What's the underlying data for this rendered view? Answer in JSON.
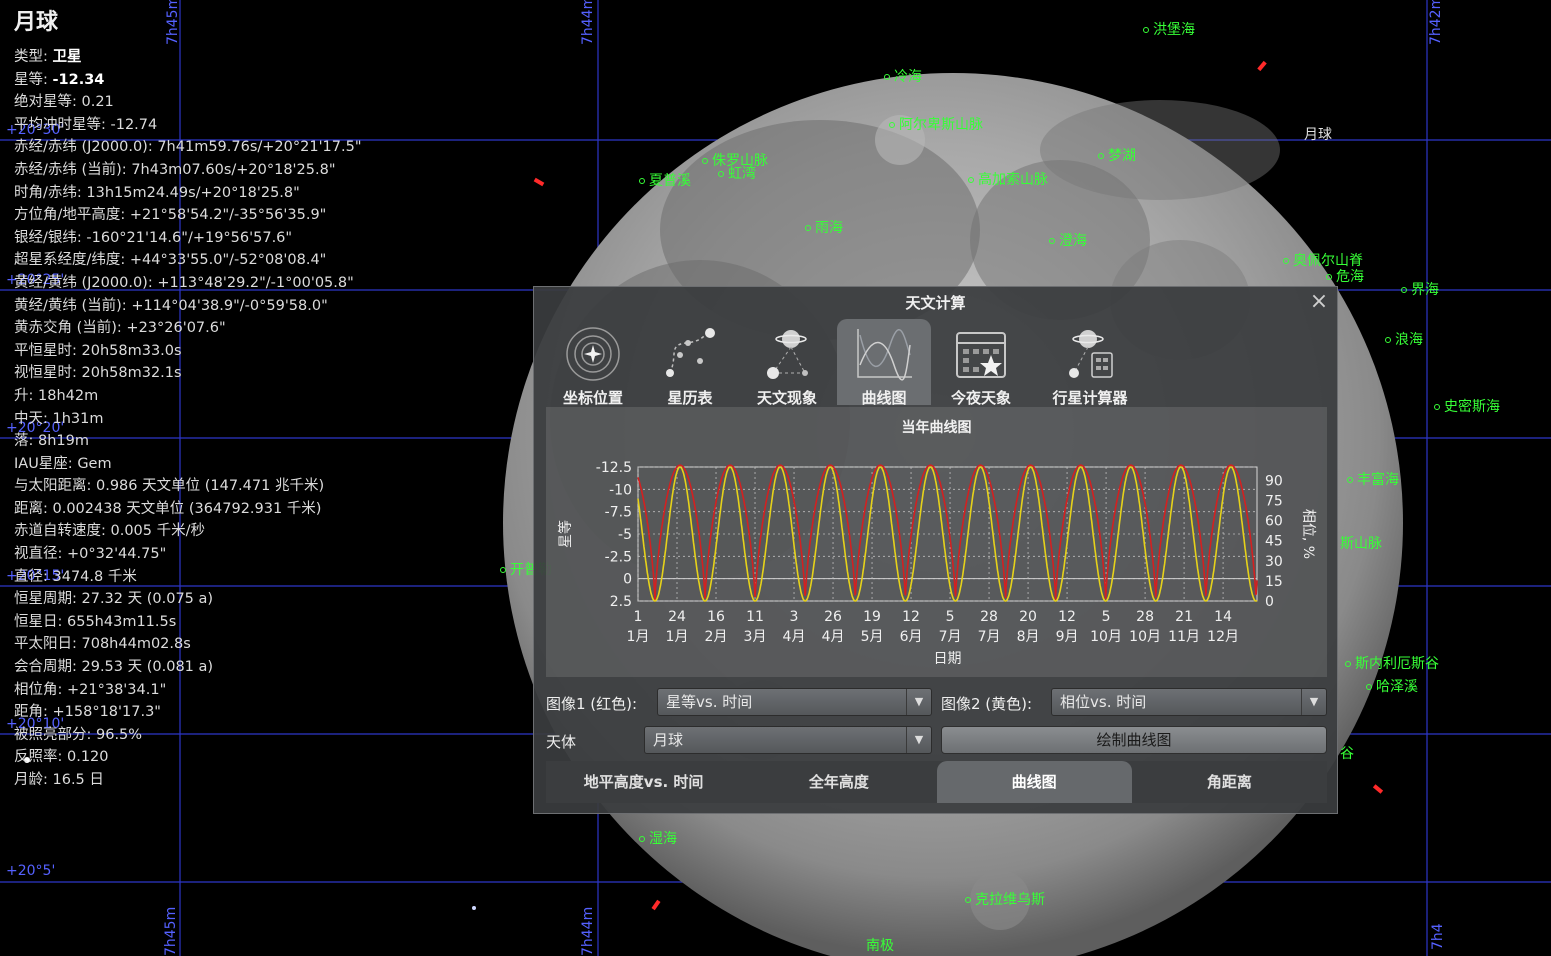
{
  "sky": {
    "grid_labels_h": [
      "7h45m",
      "7h44m",
      "7h42m",
      "7h45m",
      "7h44m",
      "7h4"
    ],
    "grid_labels_dec": [
      "+20°30'",
      "+20°25'",
      "+20°20'",
      "+20°15'",
      "+20°10'",
      "+20°5'"
    ],
    "moon_features": [
      {
        "name": "洪堡海"
      },
      {
        "name": "冷海"
      },
      {
        "name": "阿尔卑斯山脉"
      },
      {
        "name": "侏罗山脉"
      },
      {
        "name": "虹湾"
      },
      {
        "name": "夏普溪"
      },
      {
        "name": "梦湖"
      },
      {
        "name": "高加索山脉"
      },
      {
        "name": "雨海"
      },
      {
        "name": "澄海"
      },
      {
        "name": "奥佩尔山脊"
      },
      {
        "name": "危海"
      },
      {
        "name": "界海"
      },
      {
        "name": "浪海"
      },
      {
        "name": "史密斯海"
      },
      {
        "name": "丰富海"
      },
      {
        "name": "斯山脉"
      },
      {
        "name": "斯内利厄斯谷"
      },
      {
        "name": "哈泽溪"
      },
      {
        "name": "谷"
      },
      {
        "name": "克拉维乌斯"
      },
      {
        "name": "南极"
      },
      {
        "name": "湿海"
      },
      {
        "name": "开普勒"
      }
    ],
    "moon_name_label": "月球"
  },
  "info": {
    "title": "月球",
    "rows": [
      {
        "label": "类型: ",
        "value": "卫星",
        "bold": true
      },
      {
        "label": "星等: ",
        "value": "-12.34",
        "bold": true
      },
      {
        "label": "绝对星等: ",
        "value": "0.21"
      },
      {
        "label": "平均冲时星等: ",
        "value": "-12.74"
      },
      {
        "label": "赤经/赤纬 (J2000.0): ",
        "value": "7h41m59.76s/+20°21'17.5\""
      },
      {
        "label": "赤经/赤纬 (当前): ",
        "value": "7h43m07.60s/+20°18'25.8\""
      },
      {
        "label": "时角/赤纬: ",
        "value": "13h15m24.49s/+20°18'25.8\""
      },
      {
        "label": "方位角/地平高度: ",
        "value": "+21°58'54.2\"/-35°56'35.9\""
      },
      {
        "label": "银经/银纬: ",
        "value": "-160°21'14.6\"/+19°56'57.6\""
      },
      {
        "label": "超星系经度/纬度: ",
        "value": "+44°33'55.0\"/-52°08'08.4\""
      },
      {
        "label": "黄经/黄纬 (J2000.0): ",
        "value": "+113°48'29.2\"/-1°00'05.8\""
      },
      {
        "label": "黄经/黄纬 (当前): ",
        "value": "+114°04'38.9\"/-0°59'58.0\""
      },
      {
        "label": "黄赤交角 (当前): ",
        "value": "+23°26'07.6\""
      },
      {
        "label": "平恒星时: ",
        "value": "20h58m33.0s"
      },
      {
        "label": "视恒星时: ",
        "value": "20h58m32.1s"
      },
      {
        "label": "升: ",
        "value": "18h42m"
      },
      {
        "label": "中天: ",
        "value": "1h31m"
      },
      {
        "label": "落: ",
        "value": "8h19m"
      },
      {
        "label": "IAU星座: ",
        "value": "Gem"
      },
      {
        "label": "与太阳距离: ",
        "value": "0.986 天文单位 (147.471 兆千米)"
      },
      {
        "label": "距离: ",
        "value": "0.002438 天文单位 (364792.931 千米)"
      },
      {
        "label": "赤道自转速度: ",
        "value": "0.005 千米/秒"
      },
      {
        "label": "视直径: ",
        "value": "+0°32'44.75\""
      },
      {
        "label": "直径: ",
        "value": "3474.8 千米"
      },
      {
        "label": "恒星周期: ",
        "value": "27.32 天 (0.075 a)"
      },
      {
        "label": "恒星日: ",
        "value": "655h43m11.5s"
      },
      {
        "label": "平太阳日: ",
        "value": "708h44m02.8s"
      },
      {
        "label": "会合周期: ",
        "value": "29.53 天 (0.081 a)"
      },
      {
        "label": "相位角: ",
        "value": "+21°38'34.1\""
      },
      {
        "label": "距角: ",
        "value": "+158°18'17.3\""
      },
      {
        "label": "被照亮部分: ",
        "value": "96.5%"
      },
      {
        "label": "反照率: ",
        "value": "0.120"
      },
      {
        "label": "月龄: ",
        "value": "16.5 日"
      }
    ]
  },
  "dialog": {
    "title": "天文计算",
    "close_icon": "×",
    "tabs": [
      {
        "label": "坐标位置",
        "icon": "solar-system-icon"
      },
      {
        "label": "星历表",
        "icon": "ephemeris-icon"
      },
      {
        "label": "天文现象",
        "icon": "phenomena-icon"
      },
      {
        "label": "曲线图",
        "icon": "graph-icon",
        "active": true
      },
      {
        "label": "今夜天象",
        "icon": "calendar-star-icon"
      },
      {
        "label": "行星计算器",
        "icon": "planet-calculator-icon"
      }
    ],
    "chart_title": "当年曲线图",
    "graph1_label": "图像1 (红色):",
    "graph1_value": "星等vs. 时间",
    "graph2_label": "图像2 (黄色):",
    "graph2_value": "相位vs. 时间",
    "body_label": "天体",
    "body_value": "月球",
    "draw_button": "绘制曲线图",
    "subtabs": [
      {
        "label": "地平高度vs. 时间"
      },
      {
        "label": "全年高度"
      },
      {
        "label": "曲线图",
        "active": true
      },
      {
        "label": "角距离"
      }
    ]
  },
  "chart_data": {
    "type": "line",
    "title": "当年曲线图",
    "xlabel": "日期",
    "ylabel": "星等",
    "y2label": "相位, %",
    "x_ticks": [
      {
        "day": "1",
        "month": "1月"
      },
      {
        "day": "24",
        "month": "1月"
      },
      {
        "day": "16",
        "month": "2月"
      },
      {
        "day": "11",
        "month": "3月"
      },
      {
        "day": "3",
        "month": "4月"
      },
      {
        "day": "26",
        "month": "4月"
      },
      {
        "day": "19",
        "month": "5月"
      },
      {
        "day": "12",
        "month": "6月"
      },
      {
        "day": "5",
        "month": "7月"
      },
      {
        "day": "28",
        "month": "7月"
      },
      {
        "day": "20",
        "month": "8月"
      },
      {
        "day": "12",
        "month": "9月"
      },
      {
        "day": "5",
        "month": "10月"
      },
      {
        "day": "28",
        "month": "10月"
      },
      {
        "day": "21",
        "month": "11月"
      },
      {
        "day": "14",
        "month": "12月"
      }
    ],
    "y_ticks": [
      "-12.5",
      "-10",
      "-7.5",
      "-5",
      "-2.5",
      "0",
      "2.5"
    ],
    "y2_ticks": [
      "90",
      "75",
      "60",
      "45",
      "30",
      "15",
      "0"
    ],
    "ylim": [
      2.5,
      -12.5
    ],
    "y2lim": [
      0,
      100
    ],
    "grid": true,
    "series": [
      {
        "name": "星等vs. 时间",
        "color": "#d42020",
        "period_days": 29.53,
        "new_moon_day": 10,
        "min_value": 2.5,
        "max_value": -12.7,
        "mid_value": -3
      },
      {
        "name": "相位vs. 时间",
        "color": "#e6d21a",
        "period_days": 29.53,
        "new_moon_day": 10,
        "min_value": 0,
        "max_value": 100
      }
    ],
    "days_in_year": 365
  }
}
